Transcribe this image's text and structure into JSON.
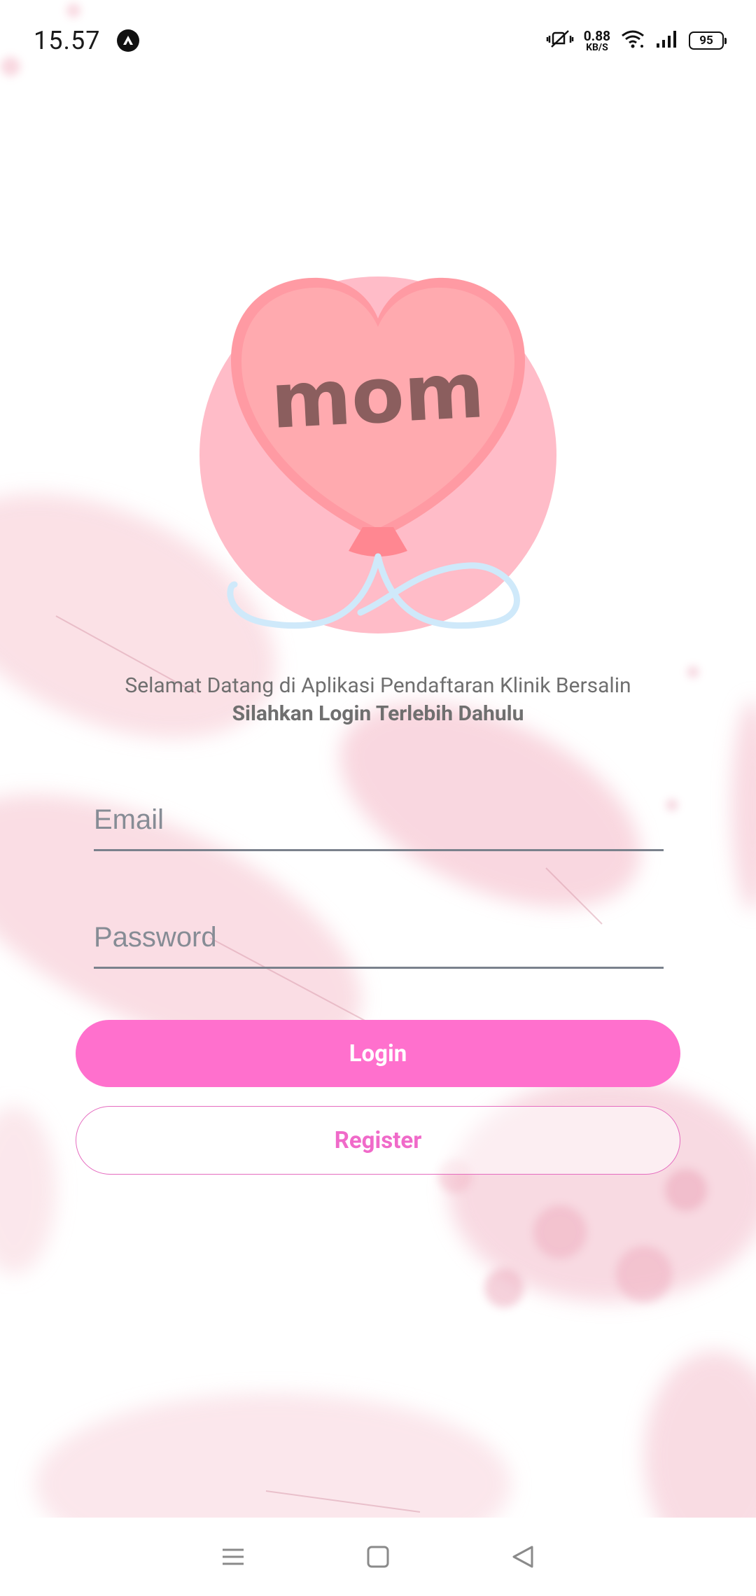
{
  "status_bar": {
    "time": "15.57",
    "net_speed_value": "0.88",
    "net_speed_unit": "KB/S",
    "battery": "95",
    "icons": [
      "app-notification-icon",
      "vibrate-icon",
      "wifi-icon",
      "signal-icon",
      "battery-icon"
    ]
  },
  "logo": {
    "text": "mom",
    "icon": "heart-balloon-logo"
  },
  "welcome": {
    "line1": "Selamat Datang di Aplikasi Pendaftaran Klinik Bersalin",
    "line2": "Silahkan Login Terlebih Dahulu"
  },
  "form": {
    "email_placeholder": "Email",
    "password_placeholder": "Password",
    "login_label": "Login",
    "register_label": "Register"
  },
  "colors": {
    "primary": "#ff70cd",
    "register_text": "#f06ac9",
    "logo_circle": "#ffbcc8",
    "heart": "#ffaaaf",
    "logo_text": "#8b5e5e",
    "string": "#cfe9fa"
  },
  "nav_bar": {
    "icons": [
      "menu-icon",
      "home-square-icon",
      "back-triangle-icon"
    ]
  }
}
